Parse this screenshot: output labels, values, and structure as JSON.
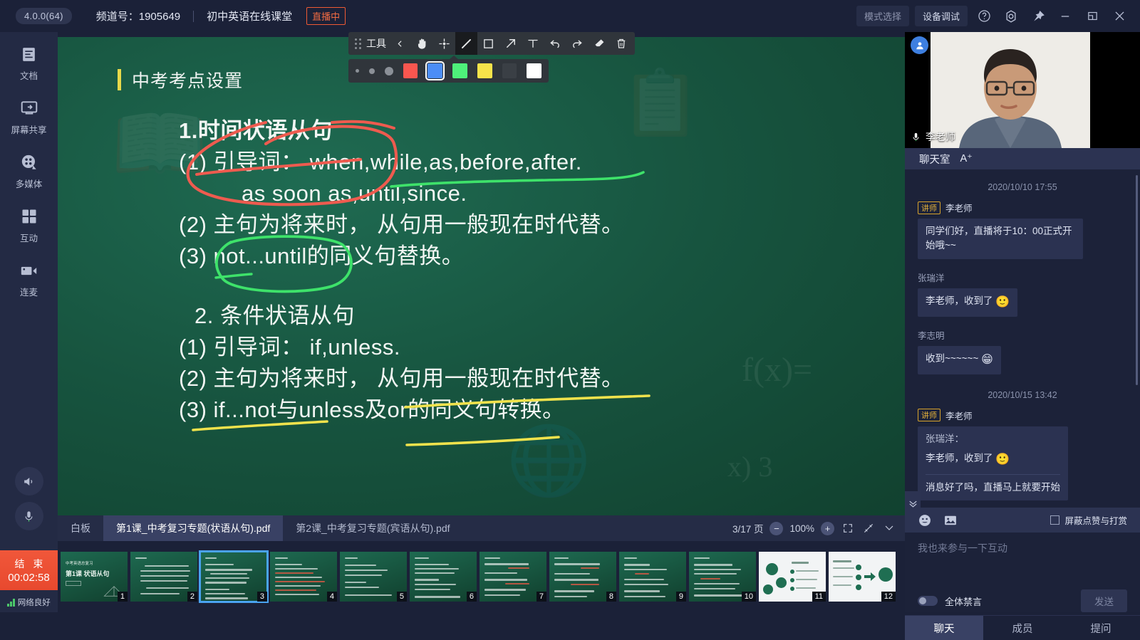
{
  "titlebar": {
    "version": "4.0.0(64)",
    "channel_label": "频道号：1905649",
    "course_title": "初中英语在线课堂",
    "live_badge": "直播中",
    "mode_select": "模式选择",
    "device_debug": "设备调试",
    "icons": [
      "help-circle-icon",
      "settings-gear-icon",
      "pin-icon",
      "minimize-icon",
      "restore-icon",
      "close-icon"
    ]
  },
  "sidebar": {
    "items": [
      {
        "label": "文档",
        "icon": "document-icon"
      },
      {
        "label": "屏幕共享",
        "icon": "screen-share-icon"
      },
      {
        "label": "多媒体",
        "icon": "multimedia-icon"
      },
      {
        "label": "互动",
        "icon": "interaction-grid-icon"
      },
      {
        "label": "连麦",
        "icon": "video-camera-icon"
      }
    ],
    "speaker_icon": "speaker-icon",
    "mic_icon": "microphone-icon",
    "end_button": {
      "label": "结 束",
      "timer": "00:02:58"
    },
    "network": {
      "label": "网络良好",
      "icon": "signal-bars-icon"
    }
  },
  "toolbar": {
    "label": "工具",
    "collapse_icon": "chevron-left-icon",
    "tools": [
      {
        "name": "hand-tool",
        "icon": "hand-icon",
        "selected": false
      },
      {
        "name": "laser-pointer-tool",
        "icon": "crosshair-icon",
        "selected": false
      },
      {
        "name": "pen-tool",
        "icon": "pen-icon",
        "selected": true
      },
      {
        "name": "rectangle-tool",
        "icon": "square-icon",
        "selected": false
      },
      {
        "name": "arrow-tool",
        "icon": "arrow-icon",
        "selected": false
      },
      {
        "name": "text-tool",
        "icon": "text-t-icon",
        "selected": false
      },
      {
        "name": "undo-tool",
        "icon": "undo-icon",
        "selected": false
      },
      {
        "name": "redo-tool",
        "icon": "redo-icon",
        "selected": false
      },
      {
        "name": "eraser-tool",
        "icon": "eraser-icon",
        "selected": false
      },
      {
        "name": "delete-tool",
        "icon": "trash-icon",
        "selected": false
      }
    ],
    "sizes": [
      3,
      5,
      8
    ],
    "colors": [
      {
        "hex": "#f9564f",
        "selected": false
      },
      {
        "hex": "#4c8df6",
        "selected": true
      },
      {
        "hex": "#4ef07a",
        "selected": false
      },
      {
        "hex": "#f6e34a",
        "selected": false
      },
      {
        "hex": "#3a3f45",
        "selected": false
      },
      {
        "hex": "#ffffff",
        "selected": false
      }
    ]
  },
  "board": {
    "title": "中考考点设置",
    "lines": [
      {
        "text": "1.时间状语从句",
        "indent": false,
        "annotation": "red-ellipse"
      },
      {
        "text": "(1) 引导词： when,while,as,before,after.",
        "indent": false,
        "annotation": "green-underline"
      },
      {
        "text": "as soon as,until,since.",
        "indent": true,
        "annotation": ""
      },
      {
        "text": "(2) 主句为将来时， 从句用一般现在时代替。",
        "indent": false,
        "annotation": ""
      },
      {
        "text": "(3) not...until的同义句替换。",
        "indent": false,
        "annotation": "green-ellipse"
      },
      {
        "text": "2. 条件状语从句",
        "indent": false,
        "annotation": ""
      },
      {
        "text": "(1) 引导词： if,unless.",
        "indent": false,
        "annotation": ""
      },
      {
        "text": "(2) 主句为将来时， 从句用一般现在时代替。",
        "indent": false,
        "annotation": ""
      },
      {
        "text": "(3) if...not与unless及or的同义句转换。",
        "indent": false,
        "annotation": "yellow-underline"
      }
    ],
    "annotation_colors": {
      "red": "#ee5b4f",
      "green": "#3ee26a",
      "yellow": "#f0e24c"
    }
  },
  "docbar": {
    "tabs": [
      {
        "label": "白板",
        "active": false
      },
      {
        "label": "第1课_中考复习专题(状语从句).pdf",
        "active": true
      },
      {
        "label": "第2课_中考复习专题(宾语从句).pdf",
        "active": false
      }
    ],
    "page_indicator": "3/17 页",
    "zoom_out": "−",
    "zoom_level": "100%",
    "zoom_in": "+",
    "fullscreen_icon": "fullscreen-icon",
    "fit_icon": "fit-page-icon",
    "collapse_icon": "chevron-down-icon"
  },
  "thumbnails": [
    {
      "num": "1",
      "style": "cover"
    },
    {
      "num": "2",
      "style": "text"
    },
    {
      "num": "3",
      "style": "text",
      "selected": true
    },
    {
      "num": "4",
      "style": "text"
    },
    {
      "num": "5",
      "style": "text"
    },
    {
      "num": "6",
      "style": "text"
    },
    {
      "num": "7",
      "style": "text"
    },
    {
      "num": "8",
      "style": "text"
    },
    {
      "num": "9",
      "style": "text"
    },
    {
      "num": "10",
      "style": "text"
    },
    {
      "num": "11",
      "style": "diagram-light"
    },
    {
      "num": "12",
      "style": "diagram-light"
    }
  ],
  "right_panel": {
    "video": {
      "speaker_name": "李老师",
      "mic_icon": "microphone-icon",
      "avatar_icon": "user-avatar-icon"
    },
    "chat_header": {
      "title": "聊天室",
      "font_size_toggle": "A⁺"
    },
    "messages": [
      {
        "type": "timestamp",
        "text": "2020/10/10 17:55"
      },
      {
        "type": "message",
        "tag": "讲师",
        "sender": "李老师",
        "text": "同学们好，直播将于10：00正式开始哦~~"
      },
      {
        "type": "message",
        "tag": "",
        "sender": "张瑞洋",
        "text": "李老师，收到了",
        "emoji": "🙂"
      },
      {
        "type": "message",
        "tag": "",
        "sender": "李志明",
        "text": "收到~~~~~~",
        "emoji": "😁"
      },
      {
        "type": "timestamp",
        "text": "2020/10/15 13:42"
      },
      {
        "type": "message",
        "tag": "讲师",
        "sender": "李老师",
        "quote": "张瑞洋：",
        "text": "李老师，收到了",
        "emoji": "🙂",
        "reply": "消息好了吗，直播马上就要开始"
      }
    ],
    "compose": {
      "emoji_icon": "emoji-icon",
      "image_icon": "image-icon",
      "block_label": "屏蔽点赞与打赏",
      "block_checked": false,
      "placeholder": "我也来参与一下互动",
      "mute_all_label": "全体禁言",
      "mute_all_on": false,
      "send_label": "发送"
    },
    "tabs": [
      {
        "label": "聊天",
        "active": true
      },
      {
        "label": "成员",
        "active": false
      },
      {
        "label": "提问",
        "active": false
      }
    ]
  },
  "accents": {
    "panel_bg": "#1c2239",
    "sidebar_bg": "#232a44",
    "active_tab": "#394164",
    "live_red": "#ef6a42",
    "end_orange": "#ee5033",
    "board_green": "#17543f",
    "select_blue": "#4aa3f0"
  }
}
